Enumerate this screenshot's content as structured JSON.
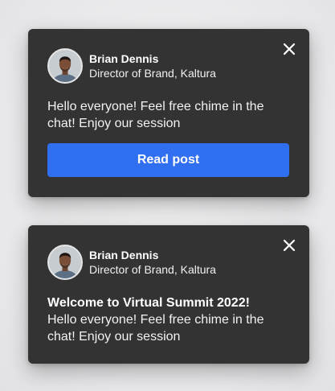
{
  "notifications": [
    {
      "author_name": "Brian Dennis",
      "author_role": "Director of Brand, Kaltura",
      "message": "Hello everyone! Feel free chime in the chat! Enjoy our session",
      "button_label": "Read post",
      "close_icon": "close-icon"
    },
    {
      "author_name": "Brian Dennis",
      "author_role": "Director of Brand, Kaltura",
      "title": "Welcome to Virtual Summit 2022!",
      "message": "Hello everyone! Feel free chime in the chat! Enjoy our session",
      "close_icon": "close-icon"
    }
  ],
  "colors": {
    "card_background": "#333334",
    "button_accent": "#2f6ff0",
    "text": "#ffffff"
  }
}
